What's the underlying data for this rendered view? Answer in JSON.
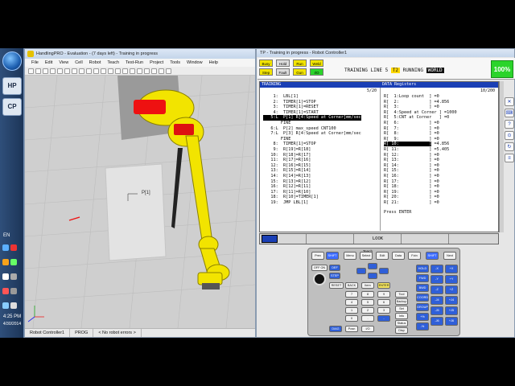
{
  "taskbar": {
    "lang": "EN",
    "time": "4:25 PM",
    "date": "4/30/2014",
    "apps": [
      "HP",
      "CP"
    ]
  },
  "handlingpro": {
    "title": "HandlingPRO - Evaluation - (7 days left) - Training in progress",
    "menu": [
      "File",
      "Edit",
      "View",
      "Cell",
      "Robot",
      "Teach",
      "Test-Run",
      "Project",
      "Tools",
      "Window",
      "Help"
    ],
    "frame_label": "P[1]",
    "status_bar": [
      "Robot Controller1",
      "PROG",
      "< No robot errors >"
    ]
  },
  "teach_pendant": {
    "title": "TP - Training in progress - Robot Controller1",
    "leds": [
      "Busy",
      "Step",
      "Hold",
      "Fault",
      "Run",
      "Gun",
      "Weld",
      "I/O"
    ],
    "program_name": "TRAINING LINE 5",
    "mode": "T2",
    "state": "RUNNING",
    "coord": "WORLD",
    "override": "100%",
    "program_header": "TRAINING",
    "program_counter": "5/20",
    "program_lines": [
      "    1:  LBL[1]",
      "    2:  TIMER[1]=STOP",
      "    3:  TIMER[1]=RESET",
      "    4:  TIMER[1]=START",
      "   5:L  P[1] R[4:Speed at Corner]mm/sec",
      "       FINE",
      "   6:L  P[2] max_speed CNT100",
      "   7:L  P[3] R[4:Speed at Corner]mm/sec",
      "       FINE",
      "    8:  TIMER[1]=STOP",
      "    9:  R[19]=R[18]",
      "   10:  R[18]=R[17]",
      "   11:  R[17]=R[16]",
      "   12:  R[16]=R[15]",
      "   13:  R[15]=R[14]",
      "   14:  R[14]=R[13]",
      "   15:  R[13]=R[12]",
      "   16:  R[12]=R[11]",
      "   17:  R[11]=R[10]",
      "   18:  R[10]=TIMER[1]",
      "   19:  JMP LBL[1]"
    ],
    "register_header": "DATA Registers",
    "register_counter": "10/200",
    "registers": [
      {
        "label": "R[  1:Loop count  ]",
        "value": "=0"
      },
      {
        "label": "R[  2:            ]",
        "value": "=4.856"
      },
      {
        "label": "R[  3:            ]",
        "value": "=0"
      },
      {
        "label": "R[  4:Speed at Corner ]",
        "value": "=1000"
      },
      {
        "label": "R[  5:CNT at Corner   ]",
        "value": "=0"
      },
      {
        "label": "R[  6:            ]",
        "value": "=0"
      },
      {
        "label": "R[  7:            ]",
        "value": "=0"
      },
      {
        "label": "R[  8:            ]",
        "value": "=0"
      },
      {
        "label": "R[  9:            ]",
        "value": "=0"
      },
      {
        "label": "R[ 10:            ]",
        "value": "=4.856"
      },
      {
        "label": "R[ 11:            ]",
        "value": "=5.405"
      },
      {
        "label": "R[ 12:            ]",
        "value": "=0"
      },
      {
        "label": "R[ 13:            ]",
        "value": "=0"
      },
      {
        "label": "R[ 14:            ]",
        "value": "=0"
      },
      {
        "label": "R[ 15:            ]",
        "value": "=0"
      },
      {
        "label": "R[ 16:            ]",
        "value": "=0"
      },
      {
        "label": "R[ 17:            ]",
        "value": "=0"
      },
      {
        "label": "R[ 18:            ]",
        "value": "=0"
      },
      {
        "label": "R[ 19:            ]",
        "value": "=0"
      },
      {
        "label": "R[ 20:            ]",
        "value": "=0"
      },
      {
        "label": "R[ 21:            ]",
        "value": "=0"
      }
    ],
    "prompt": "Press ENTER",
    "function_keys": [
      "",
      "",
      "LOOK",
      "",
      ""
    ],
    "keypad": {
      "teach_label": "Teach",
      "top_keys": [
        "Prev",
        "SHIFT",
        "Menu",
        "Select",
        "Edit",
        "Data",
        "Fctn",
        "SHIFT",
        "Next"
      ],
      "left_keys": [
        "DEF",
        "STEP",
        "RESET",
        "BACK",
        "Item",
        "ENTER"
      ],
      "num_keys": [
        "7",
        "8",
        "9",
        "4",
        "5",
        "6",
        "1",
        "2",
        "3",
        "0",
        ".",
        "-"
      ],
      "right_col": [
        "Tool",
        "Backup",
        "Set",
        "Info",
        "Status",
        "Disp"
      ],
      "jog_keys": [
        "HOLD",
        "FWD",
        "BWD",
        "COORD",
        "GROUP",
        "+%",
        "-%"
      ],
      "axis_keys": [
        "-X",
        "+X",
        "-Y",
        "+Y",
        "-Z",
        "+Z",
        "-J4",
        "+J4",
        "-J5",
        "+J5",
        "-J6",
        "+J6"
      ],
      "diag": "DIAG",
      "pos_key": "Posn",
      "io_key": "I/O",
      "dial_label": "OFF ON"
    }
  },
  "colors": {
    "tp_blue": "#1a3fb5",
    "robot_yellow": "#f2e400",
    "override_green": "#2bd42b",
    "mode_yellow": "#ffd800"
  }
}
